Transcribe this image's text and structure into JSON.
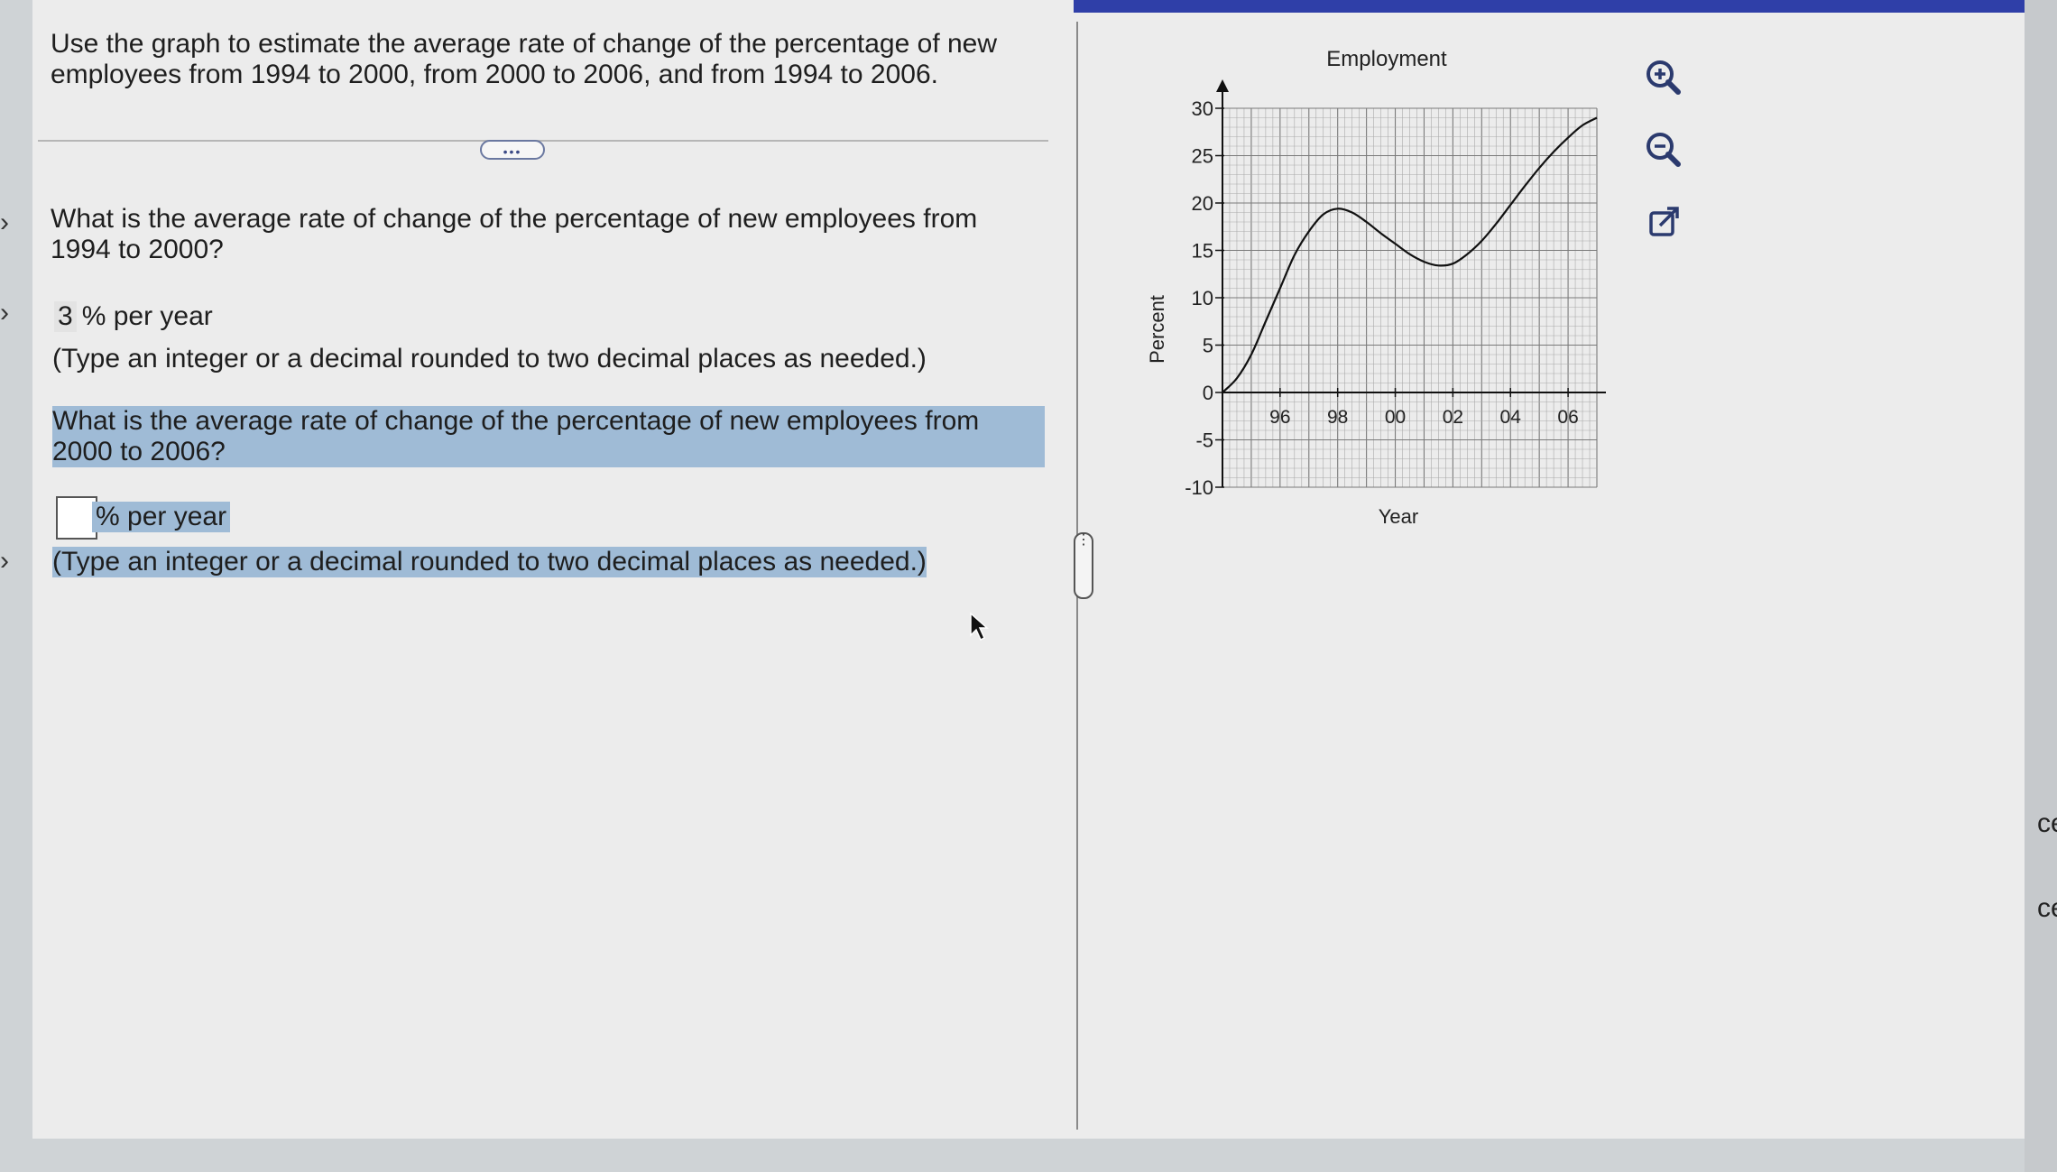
{
  "question": {
    "intro": "Use the graph to estimate the average rate of change of the percentage of new employees from 1994 to 2000, from 2000 to 2006, and from 1994 to 2006.",
    "more_button": "•••",
    "part1_question": "What is the average rate of change of the percentage of new employees from 1994 to 2000?",
    "part1_answer": "3",
    "part1_unit": "% per year",
    "part1_hint": "(Type an integer or a decimal rounded to two decimal places as needed.)",
    "part2_question": "What is the average rate of change of the percentage of new employees from 2000 to 2006?",
    "part2_answer": "",
    "part2_unit": "% per year",
    "part2_hint": "(Type an integer or a decimal rounded to two decimal places as needed.)"
  },
  "toolbar": {
    "zoom_in_icon": "zoom-in-icon",
    "zoom_out_icon": "zoom-out-icon",
    "popout_icon": "external-link-icon"
  },
  "edge_text": {
    "a": "ce",
    "b": "ce"
  },
  "colors": {
    "highlight": "#9fbbd6",
    "topbar": "#2f3fa8",
    "icon": "#2b3a6e"
  },
  "chart_data": {
    "type": "line",
    "title": "Employment",
    "xlabel": "Year",
    "ylabel": "Percent",
    "xlim": [
      1994,
      2007
    ],
    "ylim": [
      -10,
      30
    ],
    "x_ticks": [
      "96",
      "98",
      "00",
      "02",
      "04",
      "06"
    ],
    "y_ticks": [
      "30",
      "25",
      "20",
      "15",
      "10",
      "5",
      "0",
      "-5",
      "-10"
    ],
    "grid": true,
    "series": [
      {
        "x": [
          1994,
          1994.5,
          1995,
          1995.5,
          1996,
          1996.5,
          1997,
          1997.5,
          1998,
          1998.5,
          1999,
          1999.5,
          2000,
          2000.5,
          2001,
          2001.5,
          2002,
          2002.5,
          2003,
          2003.5,
          2004,
          2004.5,
          2005,
          2005.5,
          2006,
          2006.5,
          2007
        ],
        "y": [
          0,
          1.5,
          4,
          7.5,
          11,
          14.5,
          17,
          18.8,
          19.4,
          19,
          18,
          16.8,
          15.7,
          14.6,
          13.8,
          13.4,
          13.6,
          14.6,
          16,
          17.8,
          19.8,
          21.8,
          23.7,
          25.4,
          26.9,
          28.2,
          29
        ]
      }
    ]
  }
}
